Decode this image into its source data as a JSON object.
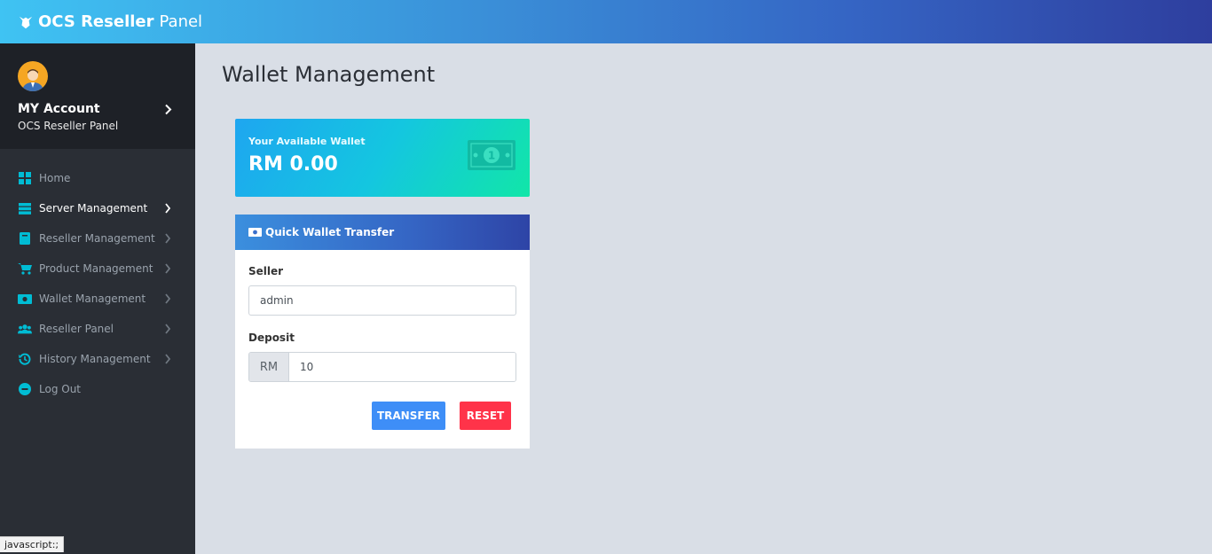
{
  "app": {
    "brand_bold": "OCS Reseller",
    "brand_light": "Panel"
  },
  "account": {
    "title": "MY Account",
    "subtitle": "OCS Reseller Panel"
  },
  "sidebar": {
    "items": [
      {
        "label": "Home",
        "icon": "dashboard-icon"
      },
      {
        "label": "Server Management",
        "icon": "server-icon"
      },
      {
        "label": "Reseller Management",
        "icon": "book-icon"
      },
      {
        "label": "Product Management",
        "icon": "cart-icon"
      },
      {
        "label": "Wallet Management",
        "icon": "money-icon"
      },
      {
        "label": "Reseller Panel",
        "icon": "users-icon"
      },
      {
        "label": "History Management",
        "icon": "history-icon"
      },
      {
        "label": "Log Out",
        "icon": "minus-circle-icon"
      }
    ]
  },
  "page": {
    "title": "Wallet Management"
  },
  "wallet": {
    "label": "Your Available Wallet",
    "amount": "RM 0.00"
  },
  "transfer": {
    "header": "Quick Wallet Transfer",
    "seller_label": "Seller",
    "seller_value": "admin",
    "deposit_label": "Deposit",
    "deposit_prefix": "RM",
    "deposit_value": "10",
    "transfer_button": "TRANSFER",
    "reset_button": "RESET"
  },
  "status_bar": {
    "text": "javascript:;"
  },
  "colors": {
    "accent": "#00bcd4",
    "transfer_button": "#3e8ef7",
    "reset_button": "#ff3349"
  }
}
